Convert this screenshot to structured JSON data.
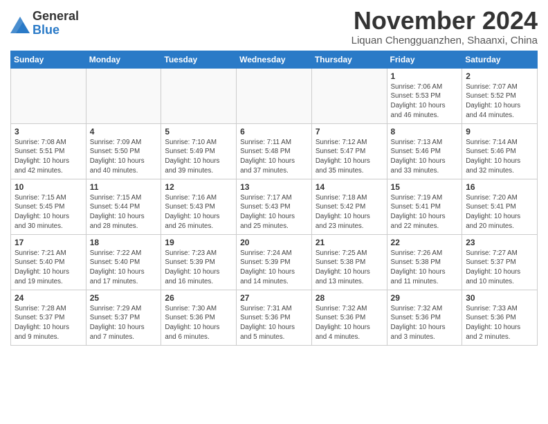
{
  "logo": {
    "general": "General",
    "blue": "Blue"
  },
  "header": {
    "month": "November 2024",
    "location": "Liquan Chengguanzhen, Shaanxi, China"
  },
  "weekdays": [
    "Sunday",
    "Monday",
    "Tuesday",
    "Wednesday",
    "Thursday",
    "Friday",
    "Saturday"
  ],
  "weeks": [
    [
      {
        "day": "",
        "info": ""
      },
      {
        "day": "",
        "info": ""
      },
      {
        "day": "",
        "info": ""
      },
      {
        "day": "",
        "info": ""
      },
      {
        "day": "",
        "info": ""
      },
      {
        "day": "1",
        "info": "Sunrise: 7:06 AM\nSunset: 5:53 PM\nDaylight: 10 hours and 46 minutes."
      },
      {
        "day": "2",
        "info": "Sunrise: 7:07 AM\nSunset: 5:52 PM\nDaylight: 10 hours and 44 minutes."
      }
    ],
    [
      {
        "day": "3",
        "info": "Sunrise: 7:08 AM\nSunset: 5:51 PM\nDaylight: 10 hours and 42 minutes."
      },
      {
        "day": "4",
        "info": "Sunrise: 7:09 AM\nSunset: 5:50 PM\nDaylight: 10 hours and 40 minutes."
      },
      {
        "day": "5",
        "info": "Sunrise: 7:10 AM\nSunset: 5:49 PM\nDaylight: 10 hours and 39 minutes."
      },
      {
        "day": "6",
        "info": "Sunrise: 7:11 AM\nSunset: 5:48 PM\nDaylight: 10 hours and 37 minutes."
      },
      {
        "day": "7",
        "info": "Sunrise: 7:12 AM\nSunset: 5:47 PM\nDaylight: 10 hours and 35 minutes."
      },
      {
        "day": "8",
        "info": "Sunrise: 7:13 AM\nSunset: 5:46 PM\nDaylight: 10 hours and 33 minutes."
      },
      {
        "day": "9",
        "info": "Sunrise: 7:14 AM\nSunset: 5:46 PM\nDaylight: 10 hours and 32 minutes."
      }
    ],
    [
      {
        "day": "10",
        "info": "Sunrise: 7:15 AM\nSunset: 5:45 PM\nDaylight: 10 hours and 30 minutes."
      },
      {
        "day": "11",
        "info": "Sunrise: 7:15 AM\nSunset: 5:44 PM\nDaylight: 10 hours and 28 minutes."
      },
      {
        "day": "12",
        "info": "Sunrise: 7:16 AM\nSunset: 5:43 PM\nDaylight: 10 hours and 26 minutes."
      },
      {
        "day": "13",
        "info": "Sunrise: 7:17 AM\nSunset: 5:43 PM\nDaylight: 10 hours and 25 minutes."
      },
      {
        "day": "14",
        "info": "Sunrise: 7:18 AM\nSunset: 5:42 PM\nDaylight: 10 hours and 23 minutes."
      },
      {
        "day": "15",
        "info": "Sunrise: 7:19 AM\nSunset: 5:41 PM\nDaylight: 10 hours and 22 minutes."
      },
      {
        "day": "16",
        "info": "Sunrise: 7:20 AM\nSunset: 5:41 PM\nDaylight: 10 hours and 20 minutes."
      }
    ],
    [
      {
        "day": "17",
        "info": "Sunrise: 7:21 AM\nSunset: 5:40 PM\nDaylight: 10 hours and 19 minutes."
      },
      {
        "day": "18",
        "info": "Sunrise: 7:22 AM\nSunset: 5:40 PM\nDaylight: 10 hours and 17 minutes."
      },
      {
        "day": "19",
        "info": "Sunrise: 7:23 AM\nSunset: 5:39 PM\nDaylight: 10 hours and 16 minutes."
      },
      {
        "day": "20",
        "info": "Sunrise: 7:24 AM\nSunset: 5:39 PM\nDaylight: 10 hours and 14 minutes."
      },
      {
        "day": "21",
        "info": "Sunrise: 7:25 AM\nSunset: 5:38 PM\nDaylight: 10 hours and 13 minutes."
      },
      {
        "day": "22",
        "info": "Sunrise: 7:26 AM\nSunset: 5:38 PM\nDaylight: 10 hours and 11 minutes."
      },
      {
        "day": "23",
        "info": "Sunrise: 7:27 AM\nSunset: 5:37 PM\nDaylight: 10 hours and 10 minutes."
      }
    ],
    [
      {
        "day": "24",
        "info": "Sunrise: 7:28 AM\nSunset: 5:37 PM\nDaylight: 10 hours and 9 minutes."
      },
      {
        "day": "25",
        "info": "Sunrise: 7:29 AM\nSunset: 5:37 PM\nDaylight: 10 hours and 7 minutes."
      },
      {
        "day": "26",
        "info": "Sunrise: 7:30 AM\nSunset: 5:36 PM\nDaylight: 10 hours and 6 minutes."
      },
      {
        "day": "27",
        "info": "Sunrise: 7:31 AM\nSunset: 5:36 PM\nDaylight: 10 hours and 5 minutes."
      },
      {
        "day": "28",
        "info": "Sunrise: 7:32 AM\nSunset: 5:36 PM\nDaylight: 10 hours and 4 minutes."
      },
      {
        "day": "29",
        "info": "Sunrise: 7:32 AM\nSunset: 5:36 PM\nDaylight: 10 hours and 3 minutes."
      },
      {
        "day": "30",
        "info": "Sunrise: 7:33 AM\nSunset: 5:36 PM\nDaylight: 10 hours and 2 minutes."
      }
    ]
  ]
}
